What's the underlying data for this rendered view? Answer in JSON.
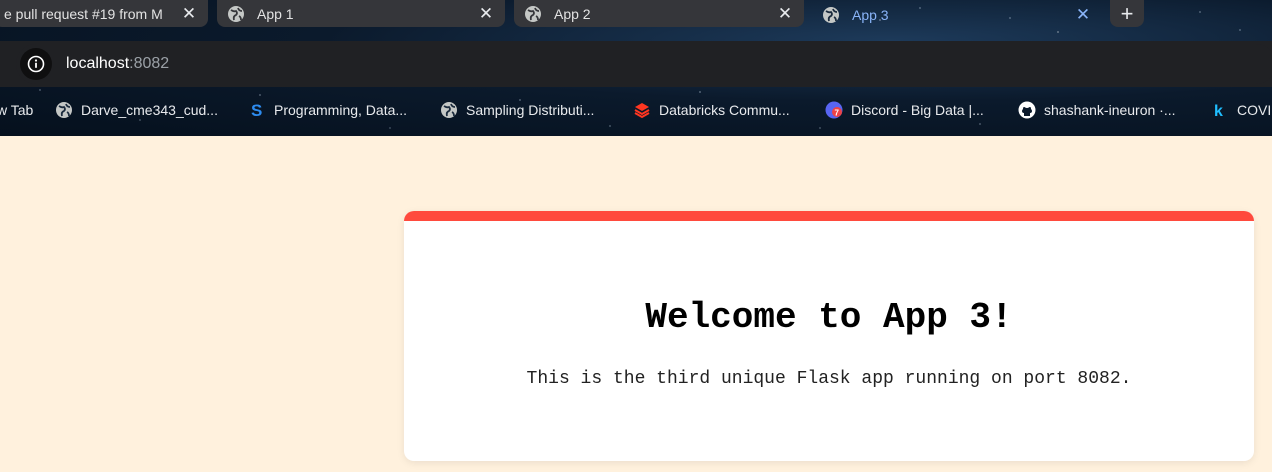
{
  "tabs": [
    {
      "title": "e pull request #19 from M",
      "close": "✕",
      "active": false
    },
    {
      "title": "App 1",
      "close": "✕",
      "active": false
    },
    {
      "title": "App 2",
      "close": "✕",
      "active": false
    },
    {
      "title": "App 3",
      "close": "✕",
      "active": true
    }
  ],
  "new_tab": "+",
  "address_bar": {
    "host": "localhost",
    "port": ":8082"
  },
  "bookmarks": [
    {
      "label": "w Tab",
      "icon": "none"
    },
    {
      "label": "Darve_cme343_cud...",
      "icon": "globe-icon"
    },
    {
      "label": "Programming, Data...",
      "icon": "s-logo-icon"
    },
    {
      "label": "Sampling Distributi...",
      "icon": "globe-icon"
    },
    {
      "label": "Databricks Commu...",
      "icon": "databricks-icon"
    },
    {
      "label": "Discord - Big Data |...",
      "icon": "discord-icon"
    },
    {
      "label": "shashank-ineuron ·...",
      "icon": "github-icon"
    },
    {
      "label": "COVID",
      "icon": "k-logo-icon"
    }
  ],
  "page": {
    "title": "Welcome to App 3!",
    "description": "This is the third unique Flask app running on port 8082."
  },
  "colors": {
    "page_background": "#fff1dd",
    "card_accent": "#ff4a3d",
    "active_tab_text": "#8ab4f8"
  }
}
